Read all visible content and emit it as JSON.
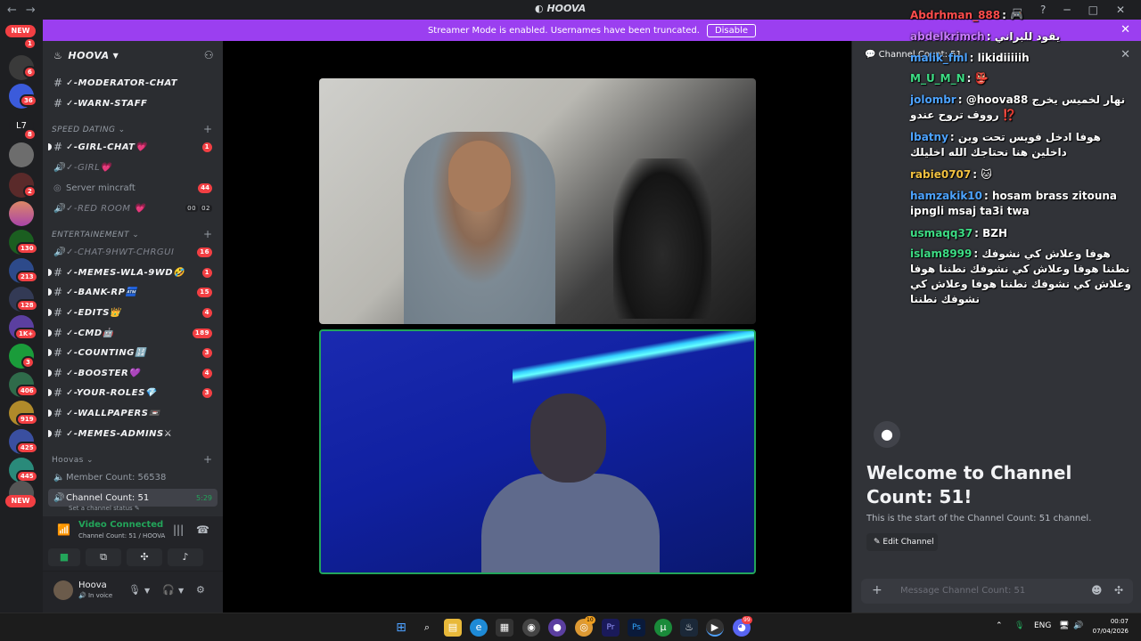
{
  "window": {
    "title": "HOOVA",
    "nav_back": "←",
    "nav_fwd": "→"
  },
  "banner": {
    "text": "Streamer Mode is enabled. Usernames have been truncated.",
    "disable_label": "Disable"
  },
  "rail": {
    "new_label": "NEW",
    "badges": [
      "1",
      "6",
      "36",
      "8",
      "2",
      "130",
      "213",
      "128",
      "1K+",
      "3",
      "406",
      "919",
      "425",
      "445"
    ],
    "l7_label": "L7"
  },
  "server": {
    "name": "HOOVA"
  },
  "channels_top": [
    {
      "name": "✓-MODERATOR-CHAT"
    },
    {
      "name": "✓-WARN-STAFF"
    }
  ],
  "cat_speed_dating": "SPEED DATING",
  "speed_dating": [
    {
      "name": "✓-GIRL-CHAT💗",
      "badge": "1"
    },
    {
      "name": "✓-GIRL💗"
    },
    {
      "name": "Server mincraft",
      "badge": "44"
    },
    {
      "name": "✓-RED ROOM 💗",
      "pair": [
        "00",
        "02"
      ]
    }
  ],
  "cat_entertainment": "ENTERTAINEMENT",
  "entertainment": [
    {
      "name": "✓-CHAT-9HWT-CHRGUI",
      "badge": "16"
    },
    {
      "name": "✓-MEMES-WLA-9WD🤣",
      "badge": "1"
    },
    {
      "name": "✓-BANK-RP🏧",
      "badge": "15"
    },
    {
      "name": "✓-EDITS👑",
      "badge": "4"
    },
    {
      "name": "✓-CMD🤖",
      "badge": "189"
    },
    {
      "name": "✓-COUNTING🔢",
      "badge": "3"
    },
    {
      "name": "✓-BOOSTER💜",
      "badge": "4"
    },
    {
      "name": "✓-YOUR-ROLES💎",
      "badge": "3"
    },
    {
      "name": "✓-WALLPAPERS📼"
    },
    {
      "name": "✓-MEMES-ADMINS⚔"
    }
  ],
  "cat_hoovas": "Hoovas",
  "hoovas": [
    {
      "name": "Member Count: 56538"
    },
    {
      "name": "Channel Count: 51",
      "timer": "5:29"
    }
  ],
  "channel_status_hint": "Set a channel status ✎",
  "voice": {
    "connected": "Video Connected",
    "sub": "Channel Count: 51 / HOOVA"
  },
  "user": {
    "name": "Hoova",
    "status": "In voice"
  },
  "chat": {
    "header": "Channel Count: 51",
    "welcome_title": "Welcome to Channel Count: 51!",
    "welcome_sub": "This is the start of the Channel Count: 51 channel.",
    "edit_label": "✎ Edit Channel",
    "placeholder": "Message Channel Count: 51"
  },
  "overlay": [
    {
      "user": "Abdrhman_888",
      "color": "#ff4d4d",
      "text": "🎮"
    },
    {
      "user": "abdelkrimch",
      "color": "#c97bff",
      "text": "يقود للبراني"
    },
    {
      "user": "malik_fml",
      "color": "#4da3ff",
      "text": "likidiiiiih"
    },
    {
      "user": "M_U_M_N",
      "color": "#3ddc84",
      "text": "👺"
    },
    {
      "user": "jolombr",
      "color": "#4da3ff",
      "text": "@hoova88 نهار لخميس يخرج رووف تروح عندو ⁉️"
    },
    {
      "user": "lbatny",
      "color": "#4da3ff",
      "text": "هوفا ادخل فويس تحت وين داخلين هنا نحتاجك الله اخليلك"
    },
    {
      "user": "rabie0707",
      "color": "#f0c040",
      "text": "🐱"
    },
    {
      "user": "hamzakik10",
      "color": "#4da3ff",
      "text": "hosam brass zitouna ipngli msaj ta3i twa"
    },
    {
      "user": "usmaqq37",
      "color": "#3ddc84",
      "text": "BZH"
    },
    {
      "user": "islam8999",
      "color": "#3ddc84",
      "text": "هوفا وعلاش كي نشوفك نطننا هوفا وعلاش كي نشوفك نطننا هوفا وعلاش كي نشوفك نطننا هوفا وعلاش كي نشوفك نطننا"
    }
  ],
  "taskbar": {
    "lang": "ENG",
    "time": "00:07",
    "date": "07/04/2026",
    "badge_a": "10",
    "badge_b": "99"
  }
}
